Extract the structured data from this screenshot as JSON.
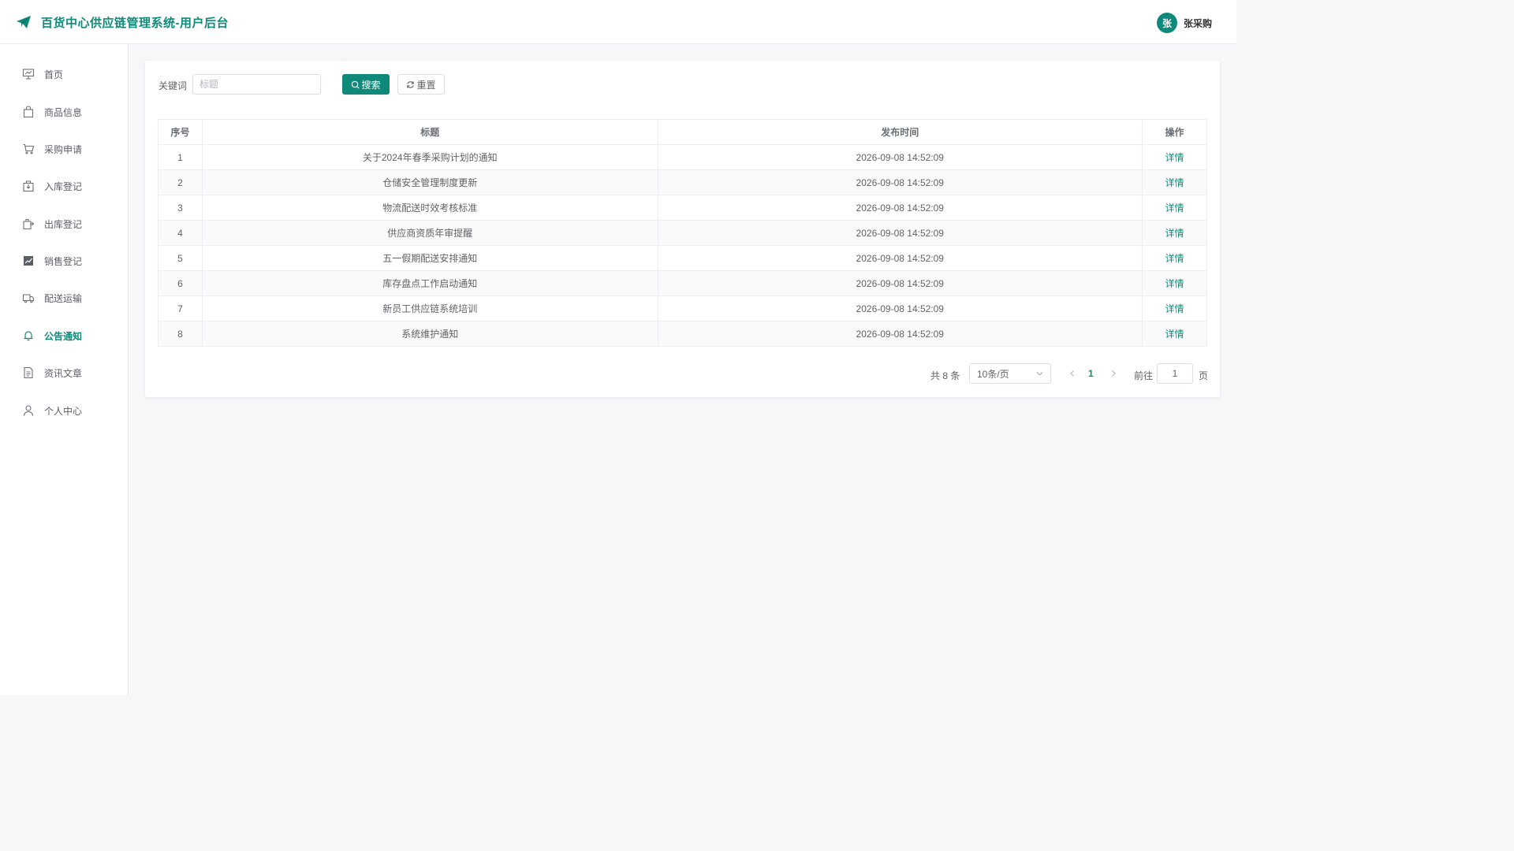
{
  "header": {
    "title": "百货中心供应链管理系统-用户后台",
    "avatar_text": "张",
    "username": "张采购",
    "brand_color": "#0f8a7a"
  },
  "sidebar": {
    "items": [
      {
        "label": "首页",
        "icon": "presentation-chart-icon",
        "active": false
      },
      {
        "label": "商品信息",
        "icon": "shopping-bag-icon",
        "active": false
      },
      {
        "label": "采购申请",
        "icon": "shopping-cart-icon",
        "active": false
      },
      {
        "label": "入库登记",
        "icon": "box-in-icon",
        "active": false
      },
      {
        "label": "出库登记",
        "icon": "box-out-icon",
        "active": false
      },
      {
        "label": "销售登记",
        "icon": "trend-chart-icon",
        "active": false
      },
      {
        "label": "配送运输",
        "icon": "truck-icon",
        "active": false
      },
      {
        "label": "公告通知",
        "icon": "bell-icon",
        "active": true
      },
      {
        "label": "资讯文章",
        "icon": "document-icon",
        "active": false
      },
      {
        "label": "个人中心",
        "icon": "user-icon",
        "active": false
      }
    ]
  },
  "search": {
    "label": "关键词",
    "placeholder": "标题",
    "value": "",
    "search_button": "搜索",
    "reset_button": "重置"
  },
  "table": {
    "columns": [
      "序号",
      "标题",
      "发布时间",
      "操作"
    ],
    "rows": [
      {
        "index": "1",
        "title": "关于2024年春季采购计划的通知",
        "time": "2026-09-08 14:52:09",
        "action": "详情"
      },
      {
        "index": "2",
        "title": "仓储安全管理制度更新",
        "time": "2026-09-08 14:52:09",
        "action": "详情"
      },
      {
        "index": "3",
        "title": "物流配送时效考核标准",
        "time": "2026-09-08 14:52:09",
        "action": "详情"
      },
      {
        "index": "4",
        "title": "供应商资质年审提醒",
        "time": "2026-09-08 14:52:09",
        "action": "详情"
      },
      {
        "index": "5",
        "title": "五一假期配送安排通知",
        "time": "2026-09-08 14:52:09",
        "action": "详情"
      },
      {
        "index": "6",
        "title": "库存盘点工作启动通知",
        "time": "2026-09-08 14:52:09",
        "action": "详情"
      },
      {
        "index": "7",
        "title": "新员工供应链系统培训",
        "time": "2026-09-08 14:52:09",
        "action": "详情"
      },
      {
        "index": "8",
        "title": "系统维护通知",
        "time": "2026-09-08 14:52:09",
        "action": "详情"
      }
    ]
  },
  "pagination": {
    "total_text": "共 8 条",
    "page_size": "10条/页",
    "current_page": "1",
    "goto_label": "前往",
    "goto_value": "1",
    "page_unit": "页"
  }
}
